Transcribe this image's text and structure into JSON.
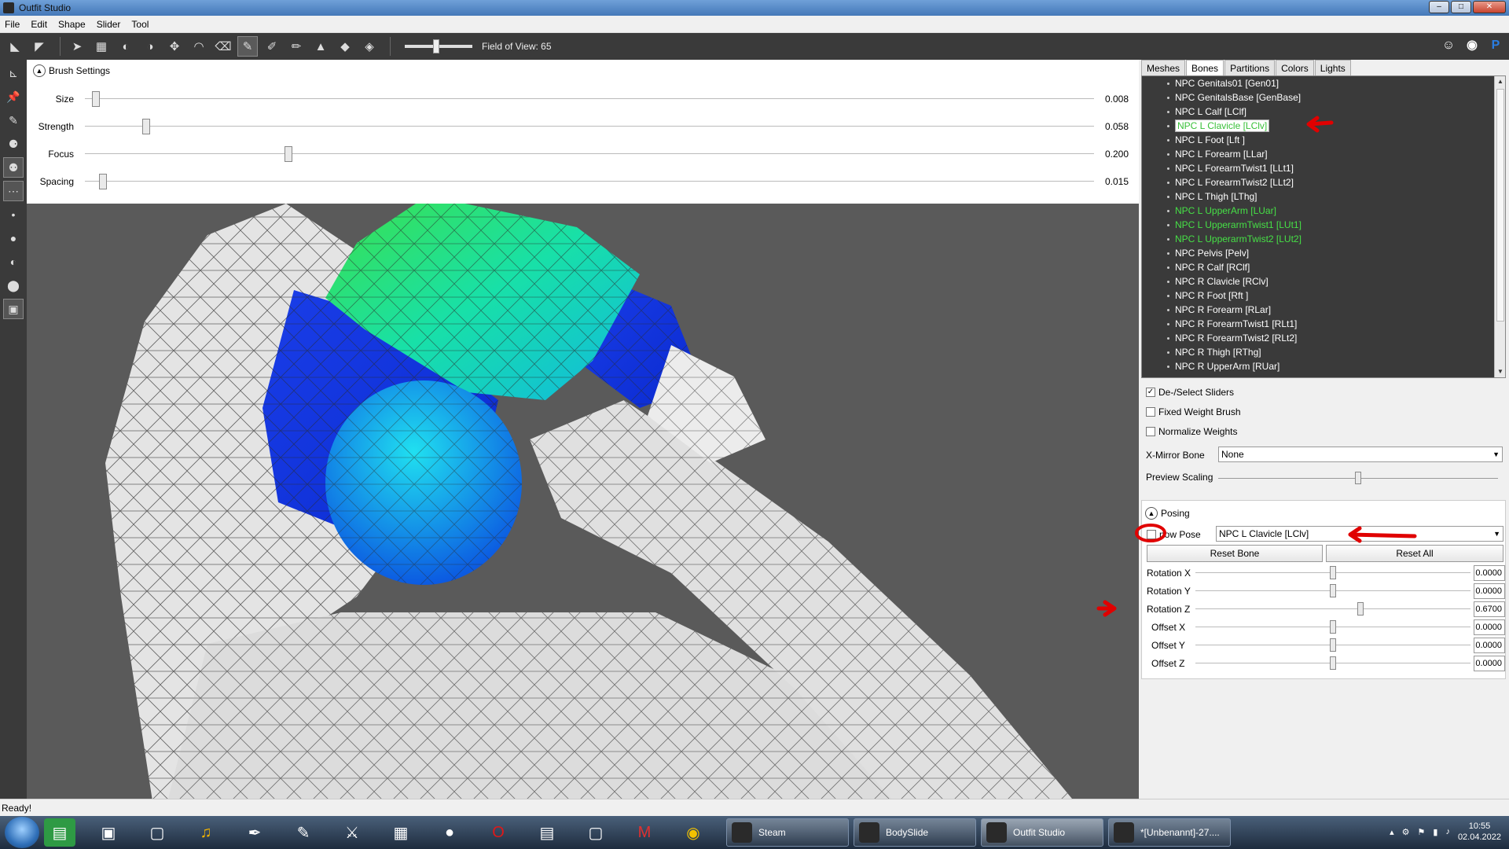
{
  "window": {
    "title": "Outfit Studio",
    "min": "–",
    "max": "□",
    "close": "✕"
  },
  "menu": [
    "File",
    "Edit",
    "Shape",
    "Slider",
    "Tool"
  ],
  "toolbar": {
    "fov_label": "Field of View: 65",
    "fov_value": 65
  },
  "brush": {
    "header": "Brush Settings",
    "rows": [
      {
        "label": "Size",
        "value": "0.008",
        "level": 0.008
      },
      {
        "label": "Strength",
        "value": "0.058",
        "level": 0.058
      },
      {
        "label": "Focus",
        "value": "0.200",
        "level": 0.2
      },
      {
        "label": "Spacing",
        "value": "0.015",
        "level": 0.015
      }
    ]
  },
  "tabs": [
    "Meshes",
    "Bones",
    "Partitions",
    "Colors",
    "Lights"
  ],
  "active_tab": "Bones",
  "bones": [
    {
      "name": "NPC Genitals01 [Gen01]",
      "state": "normal"
    },
    {
      "name": "NPC GenitalsBase [GenBase]",
      "state": "normal"
    },
    {
      "name": "NPC L Calf [LClf]",
      "state": "normal"
    },
    {
      "name": "NPC L Clavicle [LClv]",
      "state": "selected"
    },
    {
      "name": "NPC L Foot [Lft ]",
      "state": "normal"
    },
    {
      "name": "NPC L Forearm [LLar]",
      "state": "normal"
    },
    {
      "name": "NPC L ForearmTwist1 [LLt1]",
      "state": "normal"
    },
    {
      "name": "NPC L ForearmTwist2 [LLt2]",
      "state": "normal"
    },
    {
      "name": "NPC L Thigh [LThg]",
      "state": "normal"
    },
    {
      "name": "NPC L UpperArm [LUar]",
      "state": "green"
    },
    {
      "name": "NPC L UpperarmTwist1 [LUt1]",
      "state": "green"
    },
    {
      "name": "NPC L UpperarmTwist2 [LUt2]",
      "state": "green"
    },
    {
      "name": "NPC Pelvis [Pelv]",
      "state": "normal"
    },
    {
      "name": "NPC R Calf [RClf]",
      "state": "normal"
    },
    {
      "name": "NPC R Clavicle [RClv]",
      "state": "normal"
    },
    {
      "name": "NPC R Foot [Rft ]",
      "state": "normal"
    },
    {
      "name": "NPC R Forearm [RLar]",
      "state": "normal"
    },
    {
      "name": "NPC R ForearmTwist1 [RLt1]",
      "state": "normal"
    },
    {
      "name": "NPC R ForearmTwist2 [RLt2]",
      "state": "normal"
    },
    {
      "name": "NPC R Thigh [RThg]",
      "state": "normal"
    },
    {
      "name": "NPC R UpperArm [RUar]",
      "state": "normal"
    }
  ],
  "options": {
    "deselect_sliders": {
      "label": "De-/Select Sliders",
      "checked": true
    },
    "fixed_weight": {
      "label": "Fixed Weight Brush",
      "checked": false
    },
    "normalize": {
      "label": "Normalize Weights",
      "checked": false
    },
    "xmirror_label": "X-Mirror Bone",
    "xmirror_value": "None",
    "preview_label": "Preview Scaling",
    "preview_level": 0.5
  },
  "posing": {
    "header": "Posing",
    "show_pose_label": "Show Pose",
    "show_pose_visible": "now Pose",
    "bone_value": "NPC L Clavicle [LClv]",
    "reset_bone": "Reset Bone",
    "reset_all": "Reset All",
    "rows": [
      {
        "label": "Rotation X",
        "value": "0.0000",
        "level": 0.5
      },
      {
        "label": "Rotation Y",
        "value": "0.0000",
        "level": 0.5
      },
      {
        "label": "Rotation Z",
        "value": "0.6700",
        "level": 0.6
      },
      {
        "label": "Offset X",
        "value": "0.0000",
        "level": 0.5
      },
      {
        "label": "Offset Y",
        "value": "0.0000",
        "level": 0.5
      },
      {
        "label": "Offset Z",
        "value": "0.0000",
        "level": 0.5
      }
    ]
  },
  "status": "Ready!",
  "taskbar": {
    "tasks": [
      {
        "label": "Steam",
        "active": false
      },
      {
        "label": "BodySlide",
        "active": false
      },
      {
        "label": "Outfit Studio",
        "active": true
      },
      {
        "label": "*[Unbenannt]-27....",
        "active": false
      }
    ],
    "time": "10:55",
    "date": "02.04.2022"
  },
  "colors": {
    "accent_green": "#46e046",
    "annotation_red": "#e00000",
    "dark_bg": "#3a3a3a"
  }
}
